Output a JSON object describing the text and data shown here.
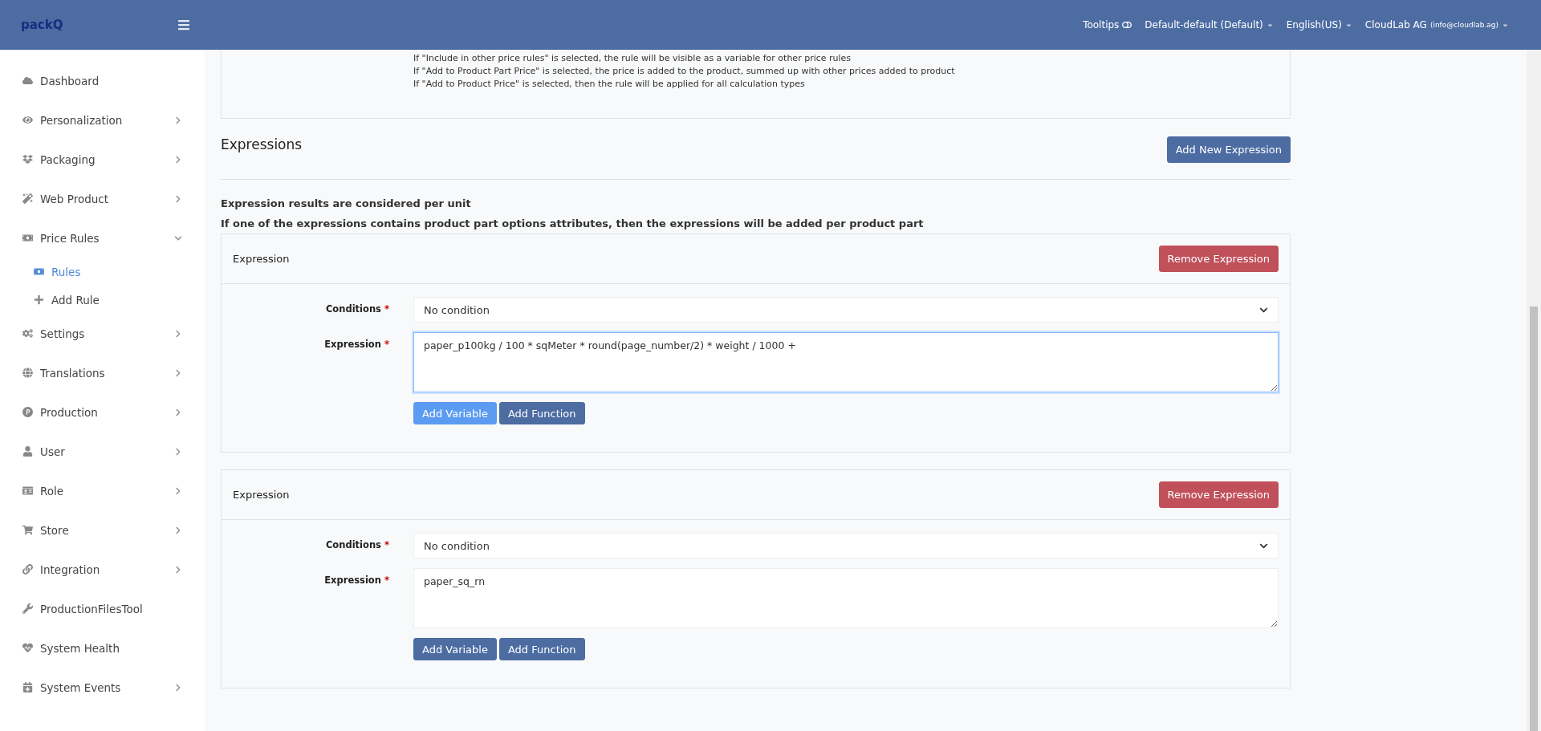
{
  "header": {
    "logo": "packQ",
    "tooltips": {
      "label": "Tooltips",
      "on": false
    },
    "dropdowns": [
      {
        "label": "Default-default (Default)"
      },
      {
        "label": "English(US)"
      },
      {
        "label": "CloudLab AG",
        "note": "(info@cloudlab.ag)"
      }
    ]
  },
  "sidebar": {
    "items": [
      {
        "label": "Dashboard",
        "has_children": false
      },
      {
        "label": "Personalization",
        "has_children": true,
        "expanded": false
      },
      {
        "label": "Packaging",
        "has_children": true,
        "expanded": false
      },
      {
        "label": "Web Product",
        "has_children": true,
        "expanded": false
      },
      {
        "label": "Price Rules",
        "has_children": true,
        "expanded": true,
        "children": [
          {
            "label": "Rules",
            "selected": true
          },
          {
            "label": "Add Rule",
            "selected": false
          }
        ]
      },
      {
        "label": "Settings",
        "has_children": true,
        "expanded": false
      },
      {
        "label": "Translations",
        "has_children": true,
        "expanded": false
      },
      {
        "label": "Production",
        "has_children": true,
        "expanded": false
      },
      {
        "label": "User",
        "has_children": true,
        "expanded": false
      },
      {
        "label": "Role",
        "has_children": true,
        "expanded": false
      },
      {
        "label": "Store",
        "has_children": true,
        "expanded": false
      },
      {
        "label": "Integration",
        "has_children": true,
        "expanded": false
      },
      {
        "label": "ProductionFilesTool",
        "has_children": false
      },
      {
        "label": "System Health",
        "has_children": false
      },
      {
        "label": "System Events",
        "has_children": true,
        "expanded": false
      }
    ]
  },
  "info_lines": [
    "If \"Include in other price rules\" is selected, the rule will be visible as a variable for other price rules",
    "If \"Add to Product Part Price\" is selected, the price is added to the product, summed up with other prices added to product",
    "If \"Add to Product Price\" is selected, then the rule will be applied for all calculation types"
  ],
  "expressions_section": {
    "title": "Expressions",
    "add_button": "Add New Expression",
    "notes": [
      "Expression results are considered per unit",
      "If one of the expressions contains product part options attributes, then the expressions will be added per product part"
    ]
  },
  "expressions": [
    {
      "title": "Expression",
      "remove_button": "Remove Expression",
      "conditions_label": "Conditions",
      "conditions_mark": "*",
      "conditions_value": "No condition",
      "expression_label": "Expression",
      "expression_mark": "*",
      "expression_value": "paper_p100kg / 100 * sqMeter * round(page_number/2) * weight / 1000 +",
      "focused": true,
      "buttons": [
        {
          "label": "Add Variable",
          "highlighted": true
        },
        {
          "label": "Add Function",
          "highlighted": false
        }
      ]
    },
    {
      "title": "Expression",
      "remove_button": "Remove Expression",
      "conditions_label": "Conditions",
      "conditions_mark": "*",
      "conditions_value": "No condition",
      "expression_label": "Expression",
      "expression_mark": "*",
      "expression_value": "paper_sq_rn",
      "focused": false,
      "buttons": [
        {
          "label": "Add Variable",
          "highlighted": false
        },
        {
          "label": "Add Function",
          "highlighted": false
        }
      ]
    }
  ]
}
